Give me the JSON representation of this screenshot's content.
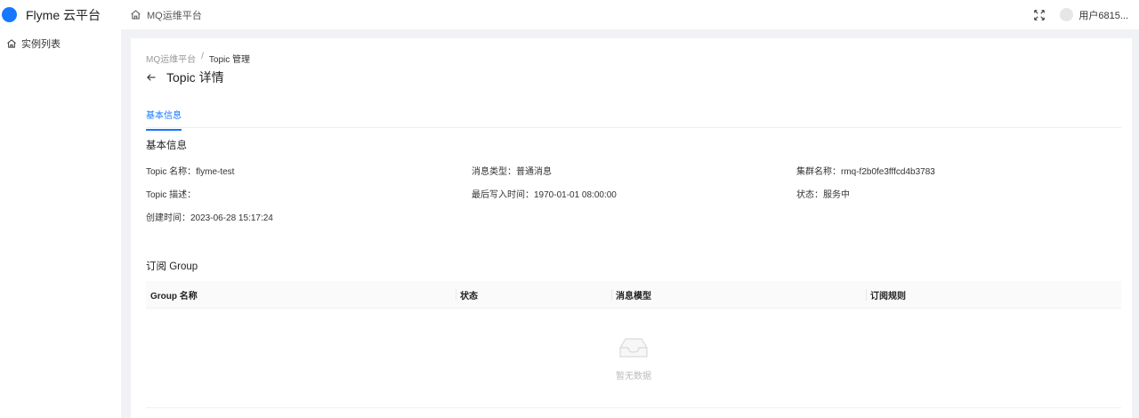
{
  "header": {
    "brand": "Flyme 云平台",
    "nav_label": "MQ运维平台",
    "user_name": "用户6815..."
  },
  "sidebar": {
    "items": [
      {
        "label": "实例列表",
        "icon": "home-icon"
      }
    ]
  },
  "breadcrumb": {
    "root": "MQ运维平台",
    "separator": "/",
    "current": "Topic 管理"
  },
  "page": {
    "title": "Topic 详情"
  },
  "tabs": [
    {
      "label": "基本信息",
      "active": true
    }
  ],
  "basic_info": {
    "section_title": "基本信息",
    "topic_name": "Topic 名称：flyme-test",
    "message_type": "消息类型：普通消息",
    "cluster_name": "集群名称：rmq-f2b0fe3fffcd4b3783",
    "topic_desc": "Topic 描述：",
    "last_write_time": "最后写入时间：1970-01-01 08:00:00",
    "status": "状态：服务中",
    "created_time": "创建时间：2023-06-28 15:17:24"
  },
  "groups": {
    "section_title": "订阅 Group",
    "columns": [
      "Group 名称",
      "状态",
      "消息模型",
      "订阅规则"
    ],
    "rows": [],
    "empty_text": "暂无数据"
  },
  "colors": {
    "accent": "#1677ff",
    "background": "#f0f2f5"
  }
}
